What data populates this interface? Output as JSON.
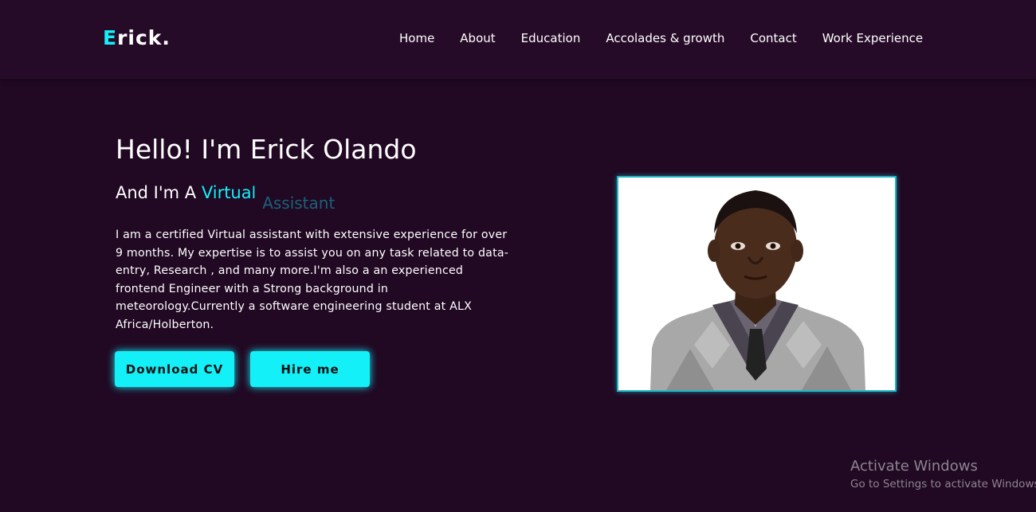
{
  "logo": {
    "first_letter": "E",
    "rest": "rick."
  },
  "nav": {
    "items": [
      {
        "label": "Home"
      },
      {
        "label": "About"
      },
      {
        "label": "Education"
      },
      {
        "label": "Accolades & growth"
      },
      {
        "label": "Contact"
      },
      {
        "label": "Work Experience"
      }
    ]
  },
  "hero": {
    "title": "Hello! I'm Erick Olando",
    "subtitle_prefix": "And I'm A ",
    "typed_text": "Virtua",
    "cursor": "l",
    "ghost_text": "Assistant",
    "bio": "I am a certified Virtual assistant with extensive experience for over 9 months. My expertise is to assist you on any task related to data-entry, Research , and many more.I'm also a an experienced frontend Engineer with a Strong background in meteorology.Currently a software engineering student at ALX Africa/Holberton.",
    "download_cv_label": "Download CV",
    "hire_me_label": "Hire me"
  },
  "colors": {
    "background": "#210823",
    "navbar": "#260b28",
    "accent": "#14f0f8"
  },
  "watermark": {
    "title": "Activate Windows",
    "subtitle": "Go to Settings to activate Windows."
  }
}
